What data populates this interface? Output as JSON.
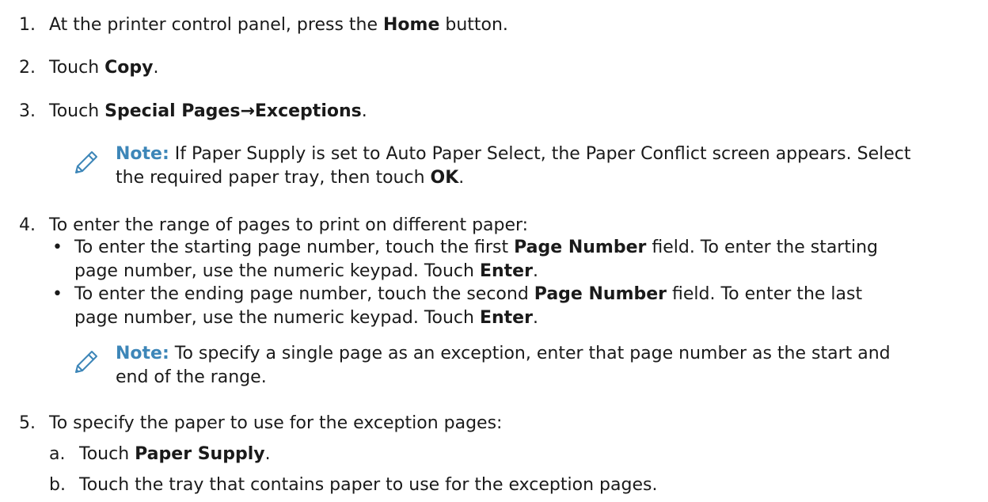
{
  "steps": [
    {
      "num": "1.",
      "pre": "At the printer control panel, press the ",
      "bold": "Home",
      "post": " button."
    },
    {
      "num": "2.",
      "pre": "Touch ",
      "bold": "Copy",
      "post": "."
    },
    {
      "num": "3.",
      "pre": "Touch ",
      "bold": "Special Pages",
      "arrow": "→",
      "bold2": "Exceptions",
      "post": "."
    },
    {
      "num": "4.",
      "text": "To enter the range of pages to print on different paper:"
    },
    {
      "num": "5.",
      "text": "To specify the paper to use for the exception pages:"
    }
  ],
  "note1": {
    "label": "Note:",
    "line1": " If Paper Supply is set to Auto Paper Select, the Paper Conflict screen appears. Select",
    "line2_pre": "the required paper tray, then touch ",
    "line2_bold": "OK",
    "line2_post": "."
  },
  "bullets": [
    {
      "line1_pre": "To enter the starting page number, touch the first ",
      "line1_bold": "Page Number",
      "line1_post": " field. To enter the starting",
      "line2_pre": "page number, use the numeric keypad. Touch ",
      "line2_bold": "Enter",
      "line2_post": "."
    },
    {
      "line1_pre": "To enter the ending page number, touch the second ",
      "line1_bold": "Page Number",
      "line1_post": " field. To enter the last",
      "line2_pre": "page number, use the numeric keypad. Touch ",
      "line2_bold": "Enter",
      "line2_post": "."
    }
  ],
  "bullet_glyph": "•",
  "note2": {
    "label": "Note:",
    "line1": " To specify a single page as an exception, enter that page number as the start and",
    "line2": "end of the range."
  },
  "substeps": [
    {
      "letter": "a.",
      "pre": "Touch ",
      "bold": "Paper Supply",
      "post": "."
    },
    {
      "letter": "b.",
      "text": "Touch the tray that contains paper to use for the exception pages."
    }
  ],
  "colors": {
    "note_accent": "#3d86b8",
    "body_text": "#1a1a1a"
  },
  "icons": {
    "note": "pencil-icon"
  }
}
